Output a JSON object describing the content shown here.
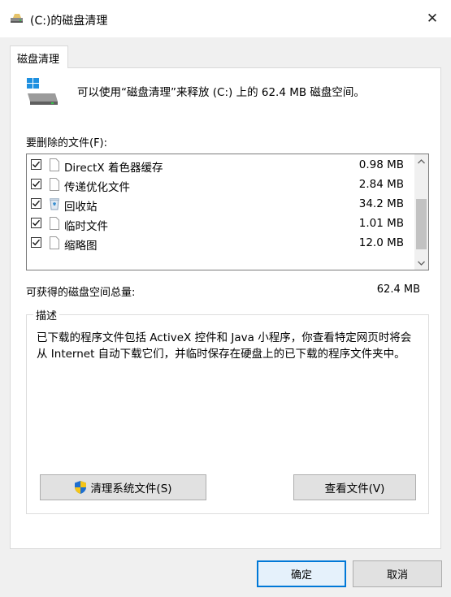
{
  "window": {
    "title": "(C:)的磁盘清理",
    "close_glyph": "✕"
  },
  "tabs": [
    {
      "label": "磁盘清理"
    }
  ],
  "info": {
    "text": "可以使用“磁盘清理”来释放  (C:) 上的 62.4 MB 磁盘空间。"
  },
  "files_section": {
    "label": "要删除的文件(F):",
    "items": [
      {
        "name": "DirectX 着色器缓存",
        "size": "0.98 MB",
        "checked": true,
        "icon": "file-icon"
      },
      {
        "name": "传递优化文件",
        "size": "2.84 MB",
        "checked": true,
        "icon": "file-icon"
      },
      {
        "name": "回收站",
        "size": "34.2 MB",
        "checked": true,
        "icon": "recycle-bin-icon"
      },
      {
        "name": "临时文件",
        "size": "1.01 MB",
        "checked": true,
        "icon": "file-icon"
      },
      {
        "name": "缩略图",
        "size": "12.0 MB",
        "checked": true,
        "icon": "file-icon"
      }
    ]
  },
  "total": {
    "label": "可获得的磁盘空间总量:",
    "value": "62.4 MB"
  },
  "description": {
    "legend": "描述",
    "text": "已下载的程序文件包括 ActiveX 控件和 Java 小程序，你查看特定网页时将会从 Internet 自动下载它们，并临时保存在硬盘上的已下载的程序文件夹中。"
  },
  "buttons": {
    "cleanup_system": "清理系统文件(S)",
    "view_files": "查看文件(V)",
    "ok": "确定",
    "cancel": "取消"
  },
  "colors": {
    "accent": "#0078d7",
    "window_bg": "#f0f0f0",
    "panel_bg": "#ffffff"
  }
}
